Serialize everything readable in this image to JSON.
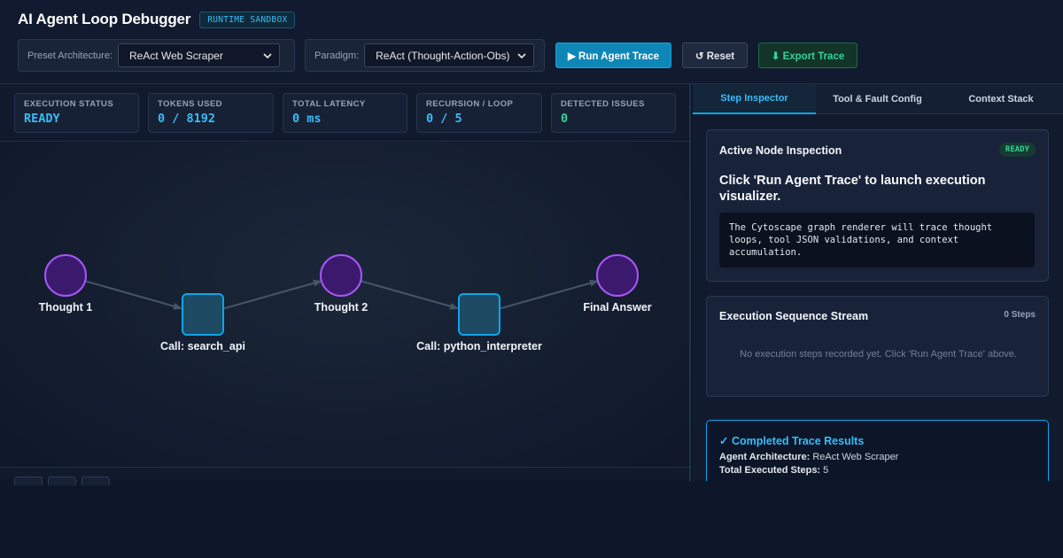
{
  "header": {
    "title": "AI Agent Loop Debugger",
    "badge": "RUNTIME SANDBOX",
    "preset_label": "Preset Architecture:",
    "preset_value": "ReAct Web Scraper",
    "paradigm_label": "Paradigm:",
    "paradigm_value": "ReAct (Thought-Action-Obs)",
    "run_label": "▶ Run Agent Trace",
    "reset_label": "↺ Reset",
    "export_label": "⬇ Export Trace"
  },
  "metrics": [
    {
      "label": "EXECUTION STATUS",
      "value": "READY"
    },
    {
      "label": "TOKENS USED",
      "value": "0 / 8192"
    },
    {
      "label": "TOTAL LATENCY",
      "value": "0 ms"
    },
    {
      "label": "RECURSION / LOOP",
      "value": "0 / 5"
    },
    {
      "label": "DETECTED ISSUES",
      "value": "0"
    }
  ],
  "graph": {
    "nodes": [
      {
        "label": "Thought 1",
        "kind": "thought"
      },
      {
        "label": "Call: search_api",
        "kind": "tool"
      },
      {
        "label": "Thought 2",
        "kind": "thought"
      },
      {
        "label": "Call: python_interpreter",
        "kind": "tool"
      },
      {
        "label": "Final Answer",
        "kind": "thought"
      }
    ],
    "colors": {
      "thought_fill": "#3b1a6e",
      "thought_stroke": "#a855f7",
      "tool_fill": "#1e4a63",
      "tool_stroke": "#0ea5e9",
      "edge": "#475569"
    }
  },
  "tabs": [
    "Step Inspector",
    "Tool & Fault Config",
    "Context Stack"
  ],
  "inspector": {
    "title": "Active Node Inspection",
    "status": "READY",
    "message": "Click 'Run Agent Trace' to launch execution visualizer.",
    "code": "The Cytoscape graph renderer will trace thought loops, tool JSON validations, and context accumulation."
  },
  "sequence": {
    "title": "Execution Sequence Stream",
    "count": "0 Steps",
    "empty": "No execution steps recorded yet. Click 'Run Agent Trace' above."
  },
  "results": {
    "title": "✓ Completed Trace Results",
    "arch_key": "Agent Architecture:",
    "arch_val": "ReAct Web Scraper",
    "steps_key": "Total Executed Steps:",
    "steps_val": "5"
  }
}
